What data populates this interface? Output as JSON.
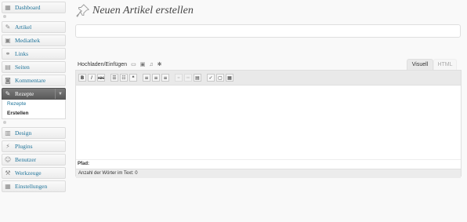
{
  "sidebar": {
    "dashboard": "Dashboard",
    "items": [
      {
        "label": "Artikel",
        "icon": "pushpin-icon"
      },
      {
        "label": "Mediathek",
        "icon": "media-icon"
      },
      {
        "label": "Links",
        "icon": "link-icon"
      },
      {
        "label": "Seiten",
        "icon": "pages-icon"
      },
      {
        "label": "Kommentare",
        "icon": "comments-icon"
      }
    ],
    "active": {
      "label": "Rezepte",
      "icon": "pushpin-icon",
      "toggle": "▼",
      "sub": [
        {
          "label": "Rezepte"
        },
        {
          "label": "Erstellen"
        }
      ]
    },
    "items2": [
      {
        "label": "Design",
        "icon": "design-icon"
      },
      {
        "label": "Plugins",
        "icon": "plugins-icon"
      },
      {
        "label": "Benutzer",
        "icon": "users-icon"
      },
      {
        "label": "Werkzeuge",
        "icon": "tools-icon"
      },
      {
        "label": "Einstellungen",
        "icon": "settings-icon"
      }
    ]
  },
  "header": {
    "title": "Neuen Artikel erstellen"
  },
  "editor": {
    "title_value": "",
    "media_label": "Hochladen/Einfügen",
    "tab_visual": "Visuell",
    "tab_html": "HTML",
    "path_label": "Pfad:",
    "wordcount": "Anzahl der Wörter im Text: 0",
    "toolbar": {
      "bold": "B",
      "italic": "I",
      "strike": "ABC"
    }
  }
}
